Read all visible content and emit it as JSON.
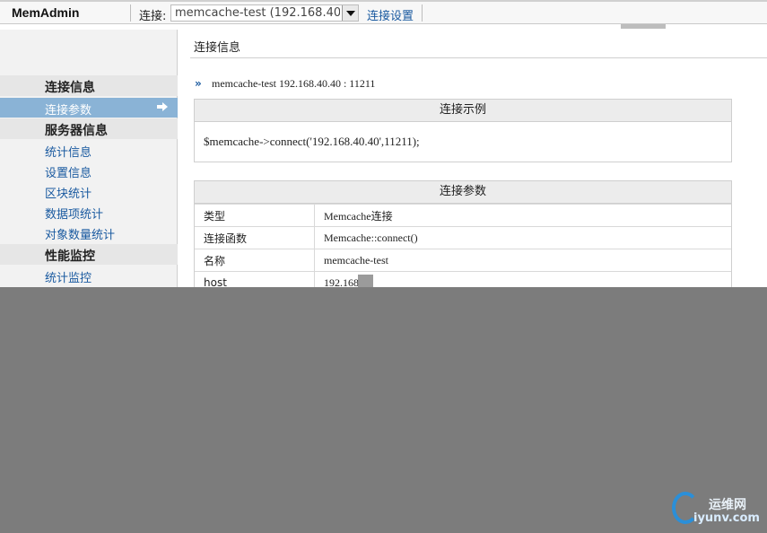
{
  "header": {
    "brand": "MemAdmin",
    "connect_label": "连接:",
    "connection_selected": "memcache-test (192.168.40.40",
    "settings_link": "连接设置"
  },
  "sidebar": {
    "sections": [
      {
        "title": "连接信息",
        "items": [
          {
            "label": "连接参数",
            "active": true
          }
        ]
      },
      {
        "title": "服务器信息",
        "items": [
          {
            "label": "统计信息"
          },
          {
            "label": "设置信息"
          },
          {
            "label": "区块统计"
          },
          {
            "label": "数据项统计"
          },
          {
            "label": "对象数量统计"
          }
        ]
      },
      {
        "title": "性能监控",
        "items": [
          {
            "label": "统计监控"
          }
        ]
      }
    ]
  },
  "main": {
    "title": "连接信息",
    "crumb_icon": "»",
    "crumb": "memcache-test 192.168.40.40 : 11211",
    "example_panel": {
      "title": "连接示例",
      "code": "$memcache->connect('192.168.40.40',11211);"
    },
    "params_panel": {
      "title": "连接参数",
      "rows": [
        {
          "key": "类型",
          "value": "Memcache连接"
        },
        {
          "key": "连接函数",
          "value": "Memcache::connect()"
        },
        {
          "key": "名称",
          "value": "memcache-test"
        },
        {
          "key": "host",
          "value": "192.168"
        }
      ]
    }
  },
  "watermark": {
    "top": "运维网",
    "bottom": "iyunv.com"
  },
  "colors": {
    "link": "#1a5aa0",
    "active_bg": "#8ab3d6",
    "overlay": "#7c7c7c"
  }
}
